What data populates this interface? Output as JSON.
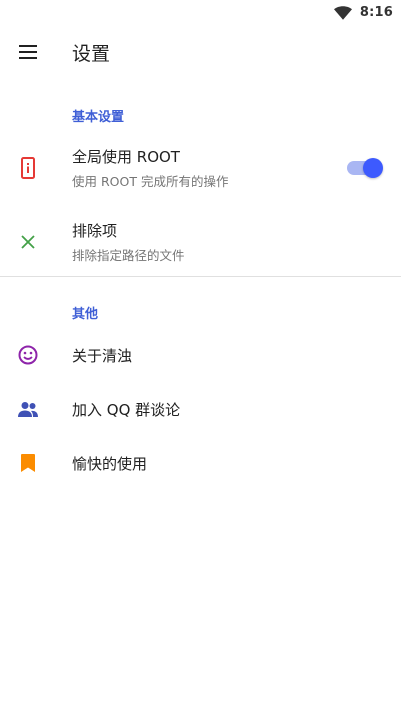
{
  "status_bar": {
    "time": "8:16",
    "wifi_icon": "wifi-icon"
  },
  "app_bar": {
    "title": "设置",
    "menu_icon": "menu-icon"
  },
  "sections": [
    {
      "header": "基本设置",
      "items": [
        {
          "title": "全局使用 ROOT",
          "subtitle": "使用 ROOT 完成所有的操作",
          "icon": "phone-info-icon",
          "icon_color": "#e53935",
          "toggle": {
            "on": true,
            "accent": "#3d5afe"
          }
        },
        {
          "title": "排除项",
          "subtitle": "排除指定路径的文件",
          "icon": "close-icon",
          "icon_color": "#43a047"
        }
      ]
    },
    {
      "header": "其他",
      "items": [
        {
          "title": "关于清浊",
          "icon": "smile-icon",
          "icon_color": "#8e24aa"
        },
        {
          "title": "加入 QQ 群谈论",
          "icon": "people-icon",
          "icon_color": "#3f51b5"
        },
        {
          "title": "愉快的使用",
          "icon": "bookmark-icon",
          "icon_color": "#fb8c00"
        }
      ]
    }
  ]
}
